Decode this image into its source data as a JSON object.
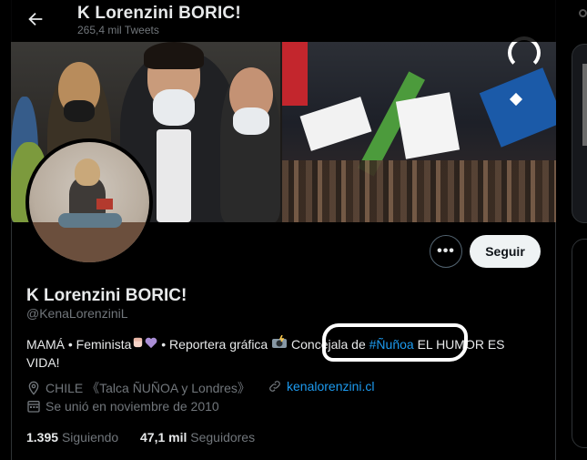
{
  "header": {
    "title": "K Lorenzini BORIC!",
    "tweet_count": "265,4 mil Tweets"
  },
  "profile": {
    "name": "K Lorenzini BORIC!",
    "handle": "@KenaLorenziniL",
    "follow_label": "Seguir",
    "more_label": "•••",
    "bio": {
      "part1": "MAMÁ • Feminista",
      "part2": " • Reportera gráfica ",
      "part3": " Concejala de ",
      "hashtag": "#Ñuñoa",
      "part4": " EL HUMOR ES VIDA!"
    },
    "location": "CHILE 《Talca ÑUÑOA y Londres》",
    "website": "kenalorenzini.cl",
    "joined": "Se unió en noviembre de 2010",
    "following_count": "1.395",
    "following_label": "Siguiendo",
    "followers_count": "47,1 mil",
    "followers_label": "Seguidores"
  },
  "icons": {
    "back": "arrow-left-icon",
    "location": "location-pin-icon",
    "link": "link-icon",
    "calendar": "calendar-icon",
    "camera": "camera-flash-emoji",
    "heart": "purple-heart-emoji",
    "fist": "raised-fist-emoji"
  },
  "colors": {
    "accent": "#1d9bf0",
    "muted": "#71767b",
    "text": "#e7e9ea",
    "background": "#000000"
  }
}
